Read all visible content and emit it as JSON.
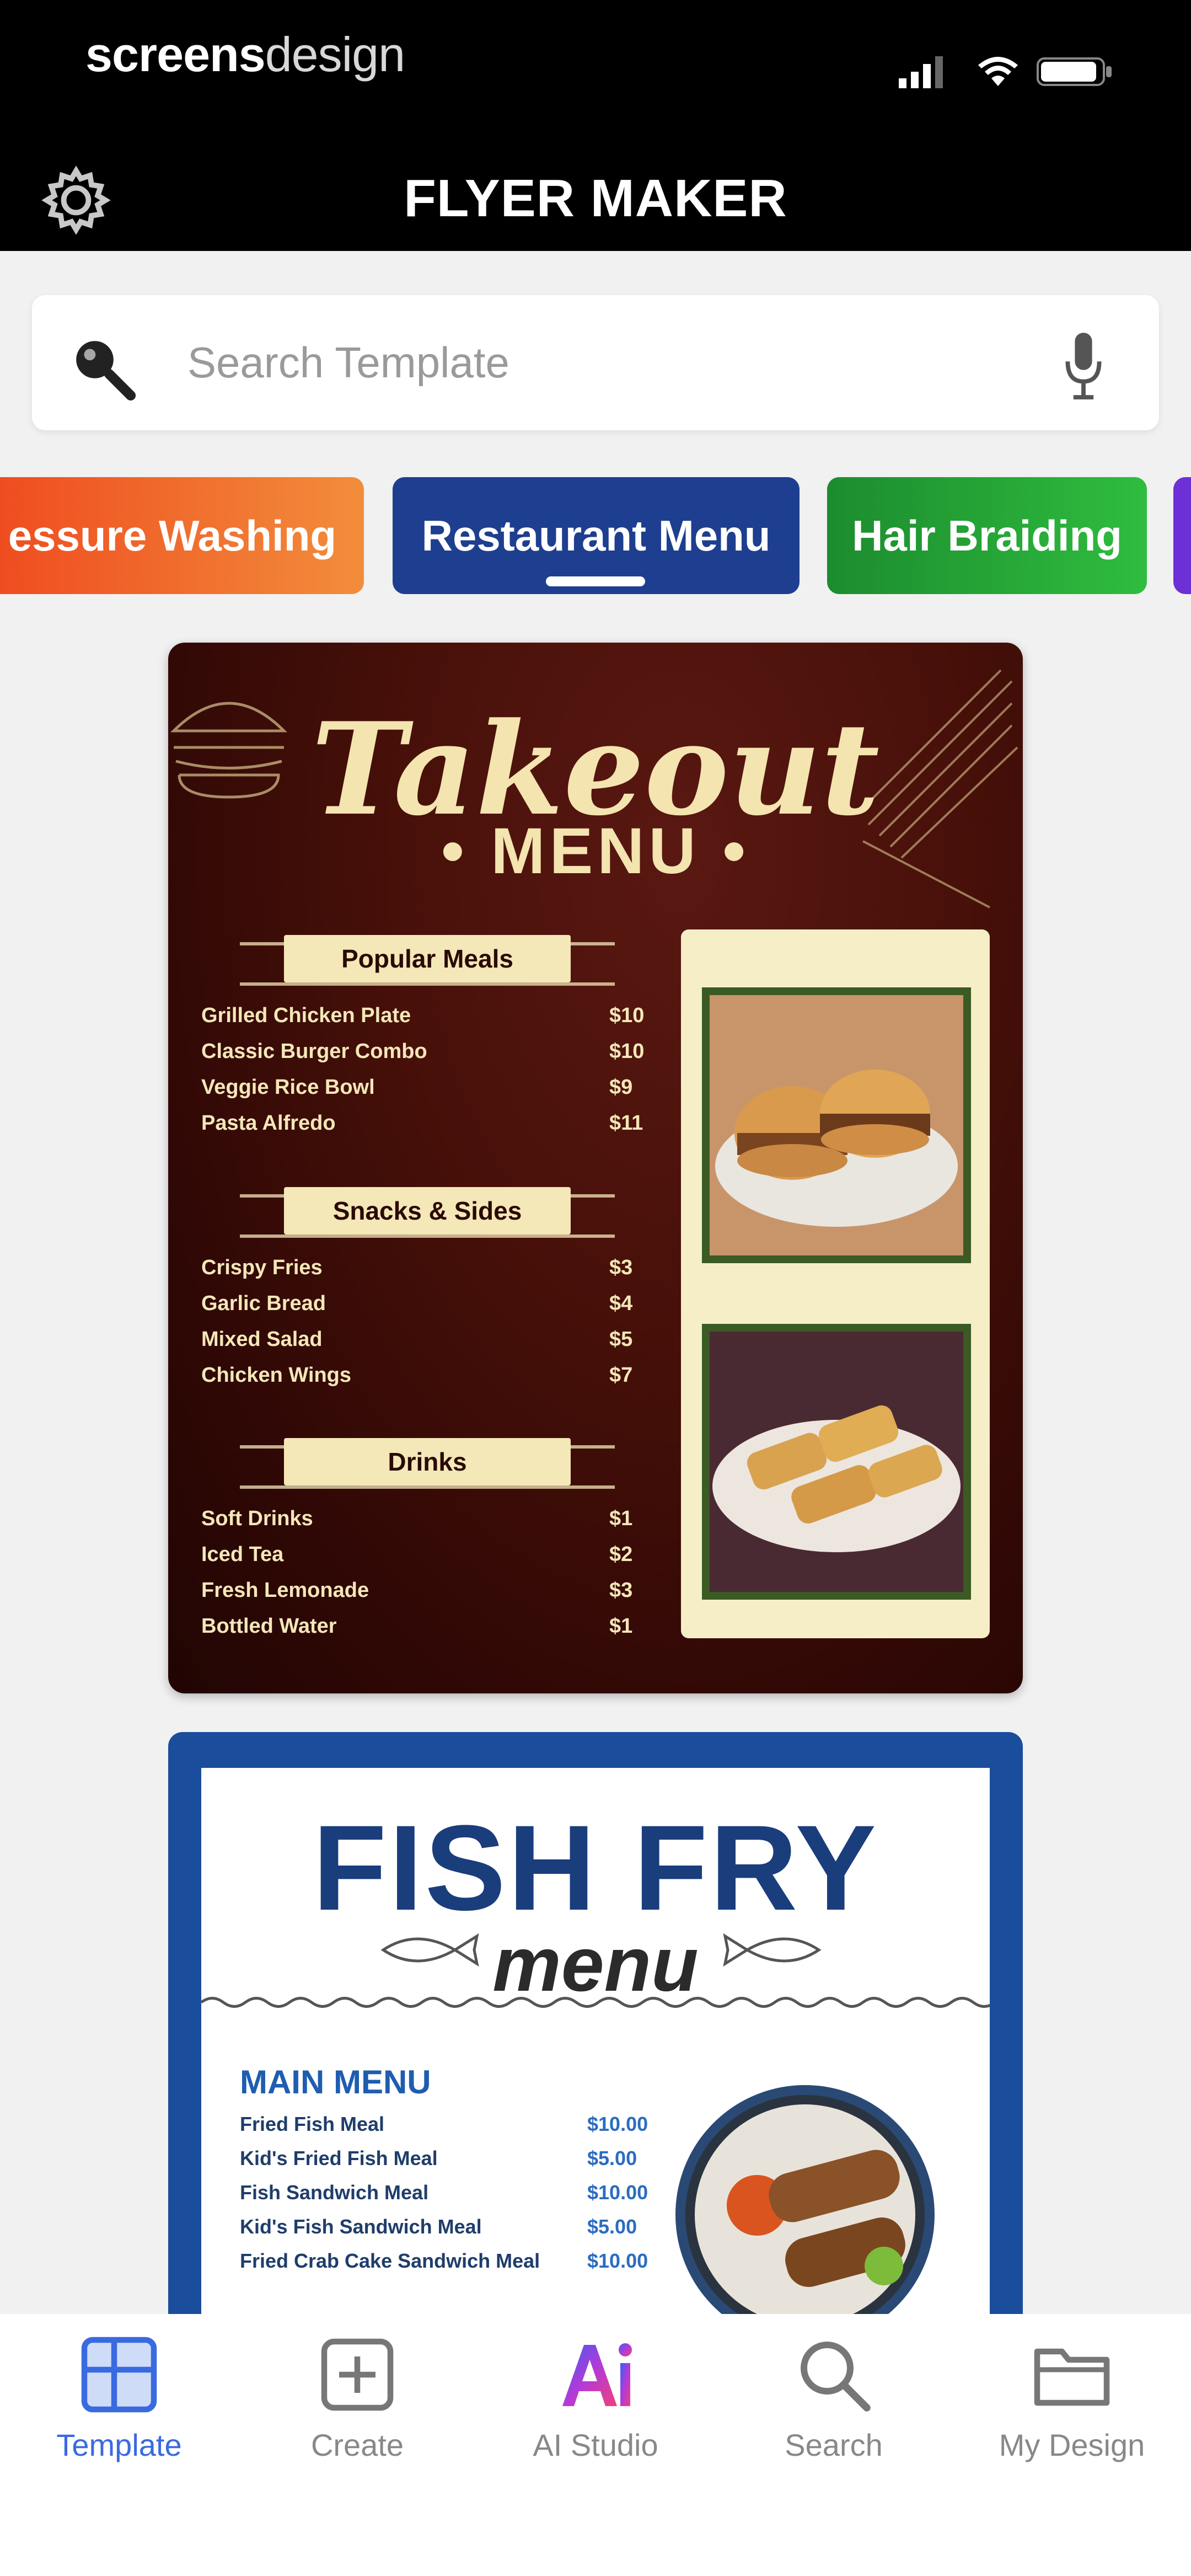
{
  "app": {
    "brand_bold": "screens",
    "brand_light": "design",
    "title": "FLYER MAKER"
  },
  "search": {
    "placeholder": "Search Template"
  },
  "categories": [
    {
      "label": "essure Washing",
      "color": "#ef4a1f"
    },
    {
      "label": "Restaurant Menu",
      "color": "#1e3f8f",
      "selected": true
    },
    {
      "label": "Hair Braiding",
      "color": "#1c8c2e"
    },
    {
      "label": "",
      "color": "#6d2fd6"
    }
  ],
  "takeout_template": {
    "title": "Takeout",
    "subtitle": "• MENU •",
    "sections": [
      {
        "label": "Popular Meals",
        "items": [
          {
            "name": "Grilled Chicken Plate",
            "price": "$10"
          },
          {
            "name": "Classic Burger Combo",
            "price": "$10"
          },
          {
            "name": "Veggie Rice Bowl",
            "price": "$9"
          },
          {
            "name": "Pasta Alfredo",
            "price": "$11"
          }
        ]
      },
      {
        "label": "Snacks & Sides",
        "items": [
          {
            "name": "Crispy Fries",
            "price": "$3"
          },
          {
            "name": "Garlic Bread",
            "price": "$4"
          },
          {
            "name": "Mixed Salad",
            "price": "$5"
          },
          {
            "name": "Chicken Wings",
            "price": "$7"
          }
        ]
      },
      {
        "label": "Drinks",
        "items": [
          {
            "name": "Soft Drinks",
            "price": "$1"
          },
          {
            "name": "Iced Tea",
            "price": "$2"
          },
          {
            "name": "Fresh Lemonade",
            "price": "$3"
          },
          {
            "name": "Bottled Water",
            "price": "$1"
          }
        ]
      }
    ]
  },
  "fishfry_template": {
    "title": "FISH FRY",
    "subtitle": "menu",
    "section": "MAIN MENU",
    "items": [
      {
        "name": "Fried Fish Meal",
        "price": "$10.00"
      },
      {
        "name": "Kid's Fried Fish Meal",
        "price": "$5.00"
      },
      {
        "name": "Fish Sandwich Meal",
        "price": "$10.00"
      },
      {
        "name": "Kid's Fish Sandwich Meal",
        "price": "$5.00"
      },
      {
        "name": "Fried Crab Cake Sandwich Meal",
        "price": "$10.00"
      }
    ]
  },
  "nav": [
    {
      "label": "Template",
      "icon": "template-icon",
      "active": true
    },
    {
      "label": "Create",
      "icon": "plus-square-icon"
    },
    {
      "label": "AI Studio",
      "icon": "ai-icon"
    },
    {
      "label": "Search",
      "icon": "search-icon"
    },
    {
      "label": "My Design",
      "icon": "folder-icon"
    }
  ],
  "colors": {
    "accent": "#3a6ae0",
    "header_bg": "#000000",
    "takeout_bg": "#471009",
    "fishfry_blue": "#1a4d9c"
  }
}
